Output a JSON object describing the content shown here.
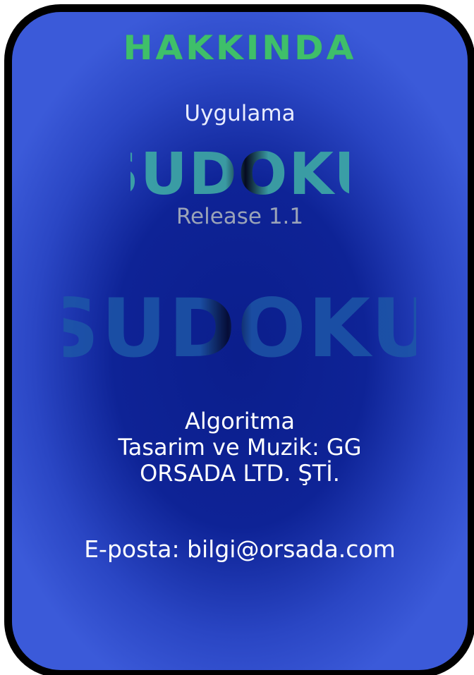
{
  "about": {
    "title": "HAKKINDA",
    "subtitle": "Uygulama",
    "logo_text": "SUDOKU",
    "release": "Release 1.1",
    "credits": [
      "Algoritma",
      "Tasarim ve Muzik: GG",
      "ORSADA LTD. ŞTİ."
    ],
    "email": "E-posta: bilgi@orsada.com"
  },
  "colors": {
    "panel_center": "#0b1e8c",
    "panel_edge": "#3b5ad9",
    "border": "#000000",
    "title": "#3fbf6a",
    "logo_small": "#3aa0a8",
    "logo_large": "#1d57a8",
    "release_text": "#9aa3b8"
  }
}
